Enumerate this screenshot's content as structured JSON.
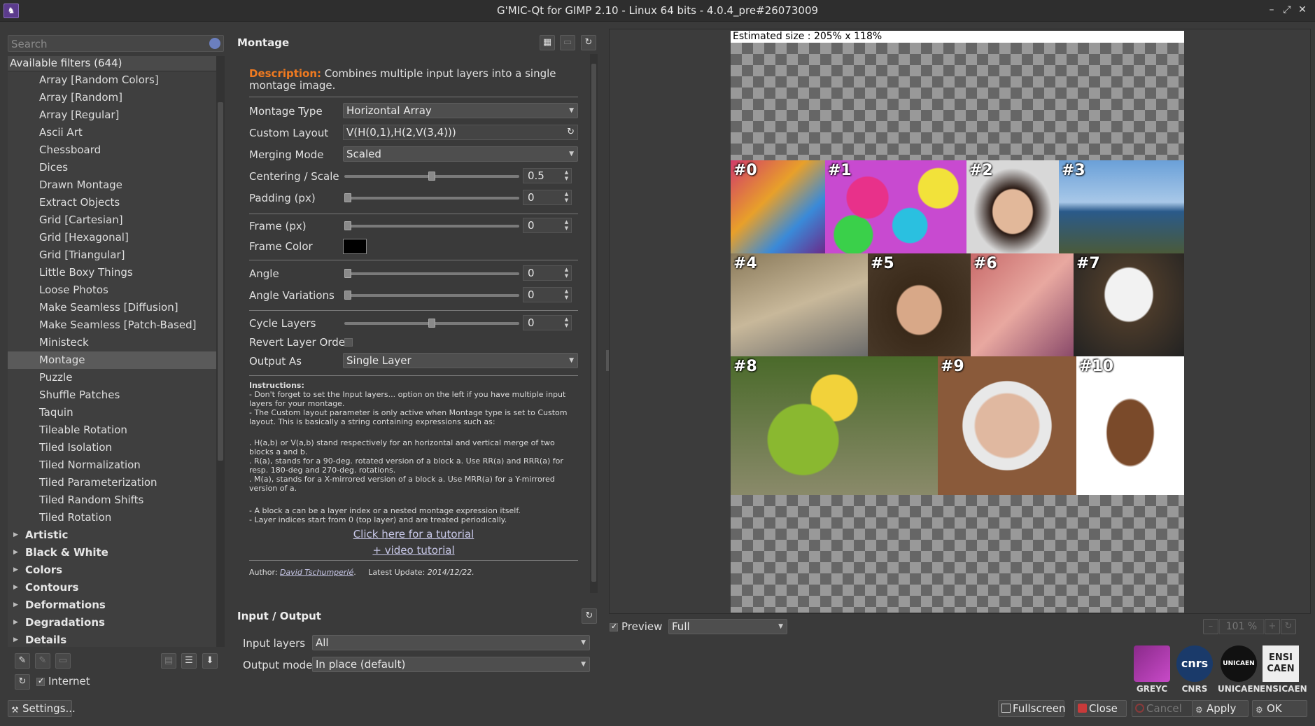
{
  "window": {
    "title": "G'MIC-Qt for GIMP 2.10 - Linux 64 bits - 4.0.4_pre#26073009"
  },
  "search": {
    "placeholder": "Search"
  },
  "filters": {
    "header": "Available filters (644)",
    "items": [
      "Array [Random Colors]",
      "Array [Random]",
      "Array [Regular]",
      "Ascii Art",
      "Chessboard",
      "Dices",
      "Drawn Montage",
      "Extract Objects",
      "Grid [Cartesian]",
      "Grid [Hexagonal]",
      "Grid [Triangular]",
      "Little Boxy Things",
      "Loose Photos",
      "Make Seamless [Diffusion]",
      "Make Seamless [Patch-Based]",
      "Ministeck",
      "Montage",
      "Puzzle",
      "Shuffle Patches",
      "Taquin",
      "Tileable Rotation",
      "Tiled Isolation",
      "Tiled Normalization",
      "Tiled Parameterization",
      "Tiled Random Shifts",
      "Tiled Rotation"
    ],
    "selected": "Montage",
    "categories": [
      "Artistic",
      "Black & White",
      "Colors",
      "Contours",
      "Deformations",
      "Degradations",
      "Details"
    ]
  },
  "internet_label": "Internet",
  "settings_label": "Settings...",
  "filter": {
    "name": "Montage",
    "desc_label": "Description:",
    "description": " Combines multiple input layers into a single montage image.",
    "params": {
      "montage_type": {
        "label": "Montage Type",
        "value": "Horizontal Array"
      },
      "custom_layout": {
        "label": "Custom Layout",
        "value": "V(H(0,1),H(2,V(3,4)))"
      },
      "merging_mode": {
        "label": "Merging Mode",
        "value": "Scaled"
      },
      "centering": {
        "label": "Centering / Scale",
        "value": "0.5",
        "level": 0.5
      },
      "padding": {
        "label": "Padding (px)",
        "value": "0"
      },
      "frame": {
        "label": "Frame (px)",
        "value": "0"
      },
      "frame_color": {
        "label": "Frame Color",
        "color": "#000000"
      },
      "angle": {
        "label": "Angle",
        "value": "0"
      },
      "angle_var": {
        "label": "Angle Variations",
        "value": "0"
      },
      "cycle": {
        "label": "Cycle Layers",
        "value": "0",
        "level": 0.5
      },
      "revert": {
        "label": "Revert Layer Order"
      },
      "output_as": {
        "label": "Output As",
        "value": "Single Layer"
      }
    },
    "instructions": {
      "title": "Instructions:",
      "l1": "- Don't forget to set the Input layers... option on the left if you have multiple input layers for your montage.",
      "l2": "- The Custom layout parameter is only active when Montage type is set to Custom layout. This is basically a string containing expressions such as:",
      "l3": ". H(a,b) or V(a,b) stand respectively for an horizontal and vertical merge of two blocks a and b.",
      "l4": ". R(a), stands for a 90-deg. rotated version of a block a. Use RR(a) and RRR(a) for resp. 180-deg and 270-deg. rotations.",
      "l5": ". M(a), stands for a X-mirrored version of a block a. Use MRR(a) for a Y-mirrored version of a.",
      "l6": "- A block a can be a layer index or a nested montage expression itself.",
      "l7": "- Layer indices start from 0 (top layer) and are treated periodically."
    },
    "tutorial_link": "Click here for a tutorial",
    "video_link": "+ video tutorial",
    "author_label": "Author:",
    "author": "David Tschumperlé",
    "update_label": "Latest Update:",
    "update": "2014/12/22."
  },
  "io": {
    "title": "Input / Output",
    "input_label": "Input layers",
    "input_value": "All",
    "output_label": "Output mode",
    "output_value": "In place (default)"
  },
  "preview": {
    "estimated": "Estimated size :  205% x 118%",
    "label": "Preview",
    "mode": "Full",
    "zoom": "101 %",
    "tiles": [
      "#0",
      "#1",
      "#2",
      "#3",
      "#4",
      "#5",
      "#6",
      "#7",
      "#8",
      "#9",
      "#10"
    ]
  },
  "logos": [
    "GREYC",
    "CNRS",
    "UNICAEN",
    "ENSICAEN"
  ],
  "logo_text": {
    "cnrs": "cnrs",
    "unicaen": "UNICAEN",
    "ensicaen": "ENSI CAEN"
  },
  "buttons": {
    "fullscreen": "Fullscreen",
    "close": "Close",
    "cancel": "Cancel",
    "apply": "Apply",
    "ok": "OK"
  }
}
